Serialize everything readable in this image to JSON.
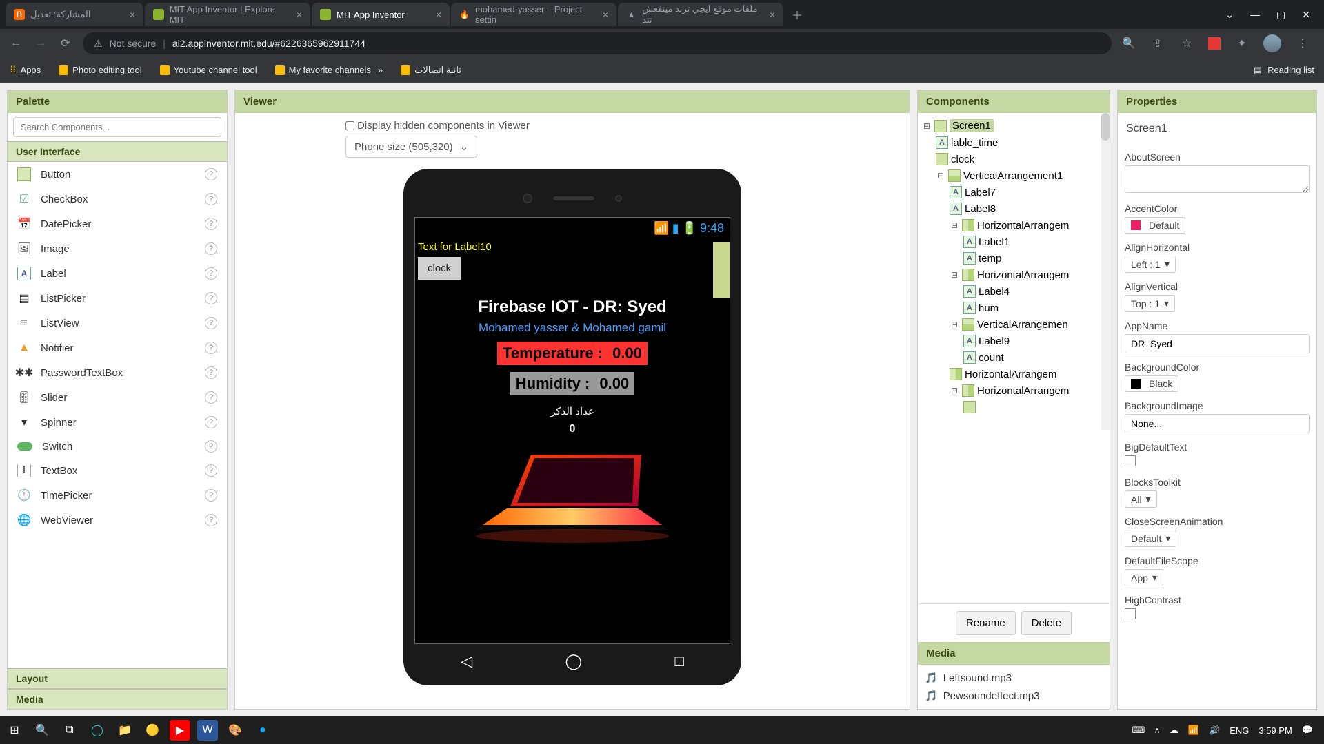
{
  "browser": {
    "tabs": [
      {
        "title": "المشاركة: تعديل"
      },
      {
        "title": "MIT App Inventor | Explore MIT"
      },
      {
        "title": "MIT App Inventor"
      },
      {
        "title": "mohamed-yasser – Project settin"
      },
      {
        "title": "ملفات موقع ايجي ترند مينفعش تتد"
      }
    ],
    "notSecure": "Not secure",
    "url": "ai2.appinventor.mit.edu/#6226365962911744",
    "bookmarks": [
      "Apps",
      "Photo editing tool",
      "Youtube channel tool",
      "My favorite channels",
      "ثانية اتصالات"
    ],
    "readingList": "Reading list"
  },
  "palette": {
    "title": "Palette",
    "searchPlaceholder": "Search Components...",
    "section1": "User Interface",
    "items": [
      "Button",
      "CheckBox",
      "DatePicker",
      "Image",
      "Label",
      "ListPicker",
      "ListView",
      "Notifier",
      "PasswordTextBox",
      "Slider",
      "Spinner",
      "Switch",
      "TextBox",
      "TimePicker",
      "WebViewer"
    ],
    "section2": "Layout",
    "section3": "Media"
  },
  "viewer": {
    "title": "Viewer",
    "hiddenLabel": "Display hidden components in Viewer",
    "sizeLabel": "Phone size (505,320)",
    "statusTime": "9:48",
    "label10": "Text for Label10",
    "clockBtn": "clock",
    "appTitle": "Firebase IOT - DR: Syed",
    "appSub": "Mohamed yasser & Mohamed gamil",
    "tempLabel": "Temperature :",
    "tempVal": "0.00",
    "humLabel": "Humidity :",
    "humVal": "0.00",
    "arabic": "عداد الذكر",
    "count": "0"
  },
  "components": {
    "title": "Components",
    "tree": {
      "screen1": "Screen1",
      "lable_time": "lable_time",
      "clock": "clock",
      "va1": "VerticalArrangement1",
      "label7": "Label7",
      "label8": "Label8",
      "ha1": "HorizontalArrangem",
      "label1": "Label1",
      "temp": "temp",
      "ha2": "HorizontalArrangem",
      "label4": "Label4",
      "hum": "hum",
      "va2": "VerticalArrangemen",
      "label9": "Label9",
      "count": "count",
      "ha3": "HorizontalArrangem",
      "ha4": "HorizontalArrangem"
    },
    "rename": "Rename",
    "delete": "Delete",
    "mediaTitle": "Media",
    "media": [
      "Leftsound.mp3",
      "Pewsoundeffect.mp3"
    ]
  },
  "properties": {
    "title": "Properties",
    "subject": "Screen1",
    "aboutScreen": "AboutScreen",
    "accentColor": "AccentColor",
    "accentDefault": "Default",
    "alignH": "AlignHorizontal",
    "alignHVal": "Left : 1",
    "alignV": "AlignVertical",
    "alignVVal": "Top : 1",
    "appName": "AppName",
    "appNameVal": "DR_Syed",
    "bgColor": "BackgroundColor",
    "bgColorVal": "Black",
    "bgImage": "BackgroundImage",
    "bgImageVal": "None...",
    "bigDefText": "BigDefaultText",
    "blocksToolkit": "BlocksToolkit",
    "blocksVal": "All",
    "closeAnim": "CloseScreenAnimation",
    "closeAnimVal": "Default",
    "fileScope": "DefaultFileScope",
    "fileScopeVal": "App",
    "highContrast": "HighContrast"
  },
  "taskbar": {
    "lang": "ENG",
    "time": "3:59 PM"
  }
}
